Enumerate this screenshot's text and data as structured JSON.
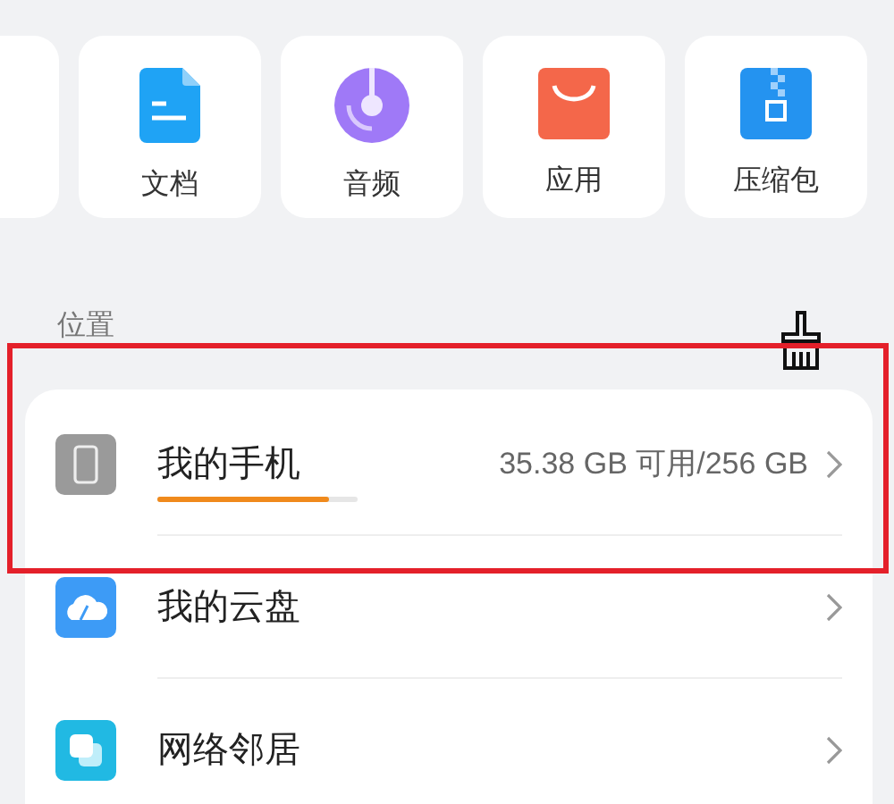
{
  "categories": [
    {
      "label": "文档",
      "kind": "document"
    },
    {
      "label": "音频",
      "kind": "audio"
    },
    {
      "label": "应用",
      "kind": "app"
    },
    {
      "label": "压缩包",
      "kind": "archive"
    }
  ],
  "locations_section": {
    "title": "位置",
    "items": [
      {
        "name": "我的手机",
        "kind": "phone",
        "level": 0.86,
        "reading": "35.38 GB 可用/256 GB"
      },
      {
        "name": "我的云盘",
        "kind": "cloud"
      },
      {
        "name": "网络邻居",
        "kind": "network"
      }
    ]
  }
}
